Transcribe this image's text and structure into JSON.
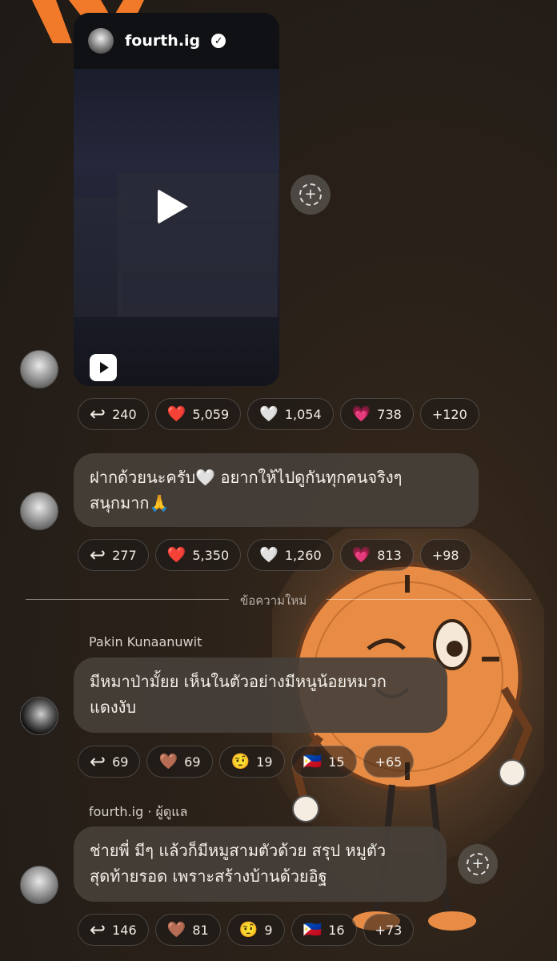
{
  "video_post": {
    "username": "fourth.ig",
    "verified_mark": "✓",
    "reactions": [
      {
        "icon": "↩",
        "count": "240",
        "name": "reply"
      },
      {
        "icon": "❤️",
        "count": "5,059",
        "name": "red-heart"
      },
      {
        "icon": "🤍",
        "count": "1,054",
        "name": "white-heart"
      },
      {
        "icon": "💗",
        "count": "738",
        "name": "pink-heart"
      },
      {
        "icon": "",
        "count": "+120",
        "name": "more"
      }
    ]
  },
  "message_1": {
    "text_line1": "ฝากด้วยนะครับ🤍 อยากให้ไปดูกันทุกคนจริงๆ",
    "text_line2": "สนุกมาก🙏",
    "reactions": [
      {
        "icon": "↩",
        "count": "277"
      },
      {
        "icon": "❤️",
        "count": "5,350"
      },
      {
        "icon": "🤍",
        "count": "1,260"
      },
      {
        "icon": "💗",
        "count": "813"
      },
      {
        "icon": "",
        "count": "+98"
      }
    ]
  },
  "divider": {
    "label": "ข้อความใหม่"
  },
  "message_2": {
    "sender": "Pakin Kunaanuwit",
    "text_line1": "มีหมาป่ามั้ยย เห็นในตัวอย่างมีหนูน้อยหมวก",
    "text_line2": "แดงงับ",
    "reactions": [
      {
        "icon": "↩",
        "count": "69"
      },
      {
        "icon": "🤎",
        "count": "69"
      },
      {
        "icon": "🤨",
        "count": "19"
      },
      {
        "icon": "🇵🇭",
        "count": "15"
      },
      {
        "icon": "",
        "count": "+65"
      }
    ]
  },
  "message_3": {
    "sender": "fourth.ig · ผู้ดูแล",
    "text_line1": "ช่ายพี่ มีๆ แล้วก็มีหมูสามตัวด้วย สรุป หมูตัว",
    "text_line2": "สุดท้ายรอด เพราะสร้างบ้านด้วยอิฐ",
    "reactions": [
      {
        "icon": "↩",
        "count": "146"
      },
      {
        "icon": "🤎",
        "count": "81"
      },
      {
        "icon": "🤨",
        "count": "9"
      },
      {
        "icon": "🇵🇭",
        "count": "16"
      },
      {
        "icon": "",
        "count": "+73"
      }
    ]
  },
  "colors": {
    "logo": "#f07a2a",
    "bubble": "#46403a",
    "background": "#241d18"
  }
}
